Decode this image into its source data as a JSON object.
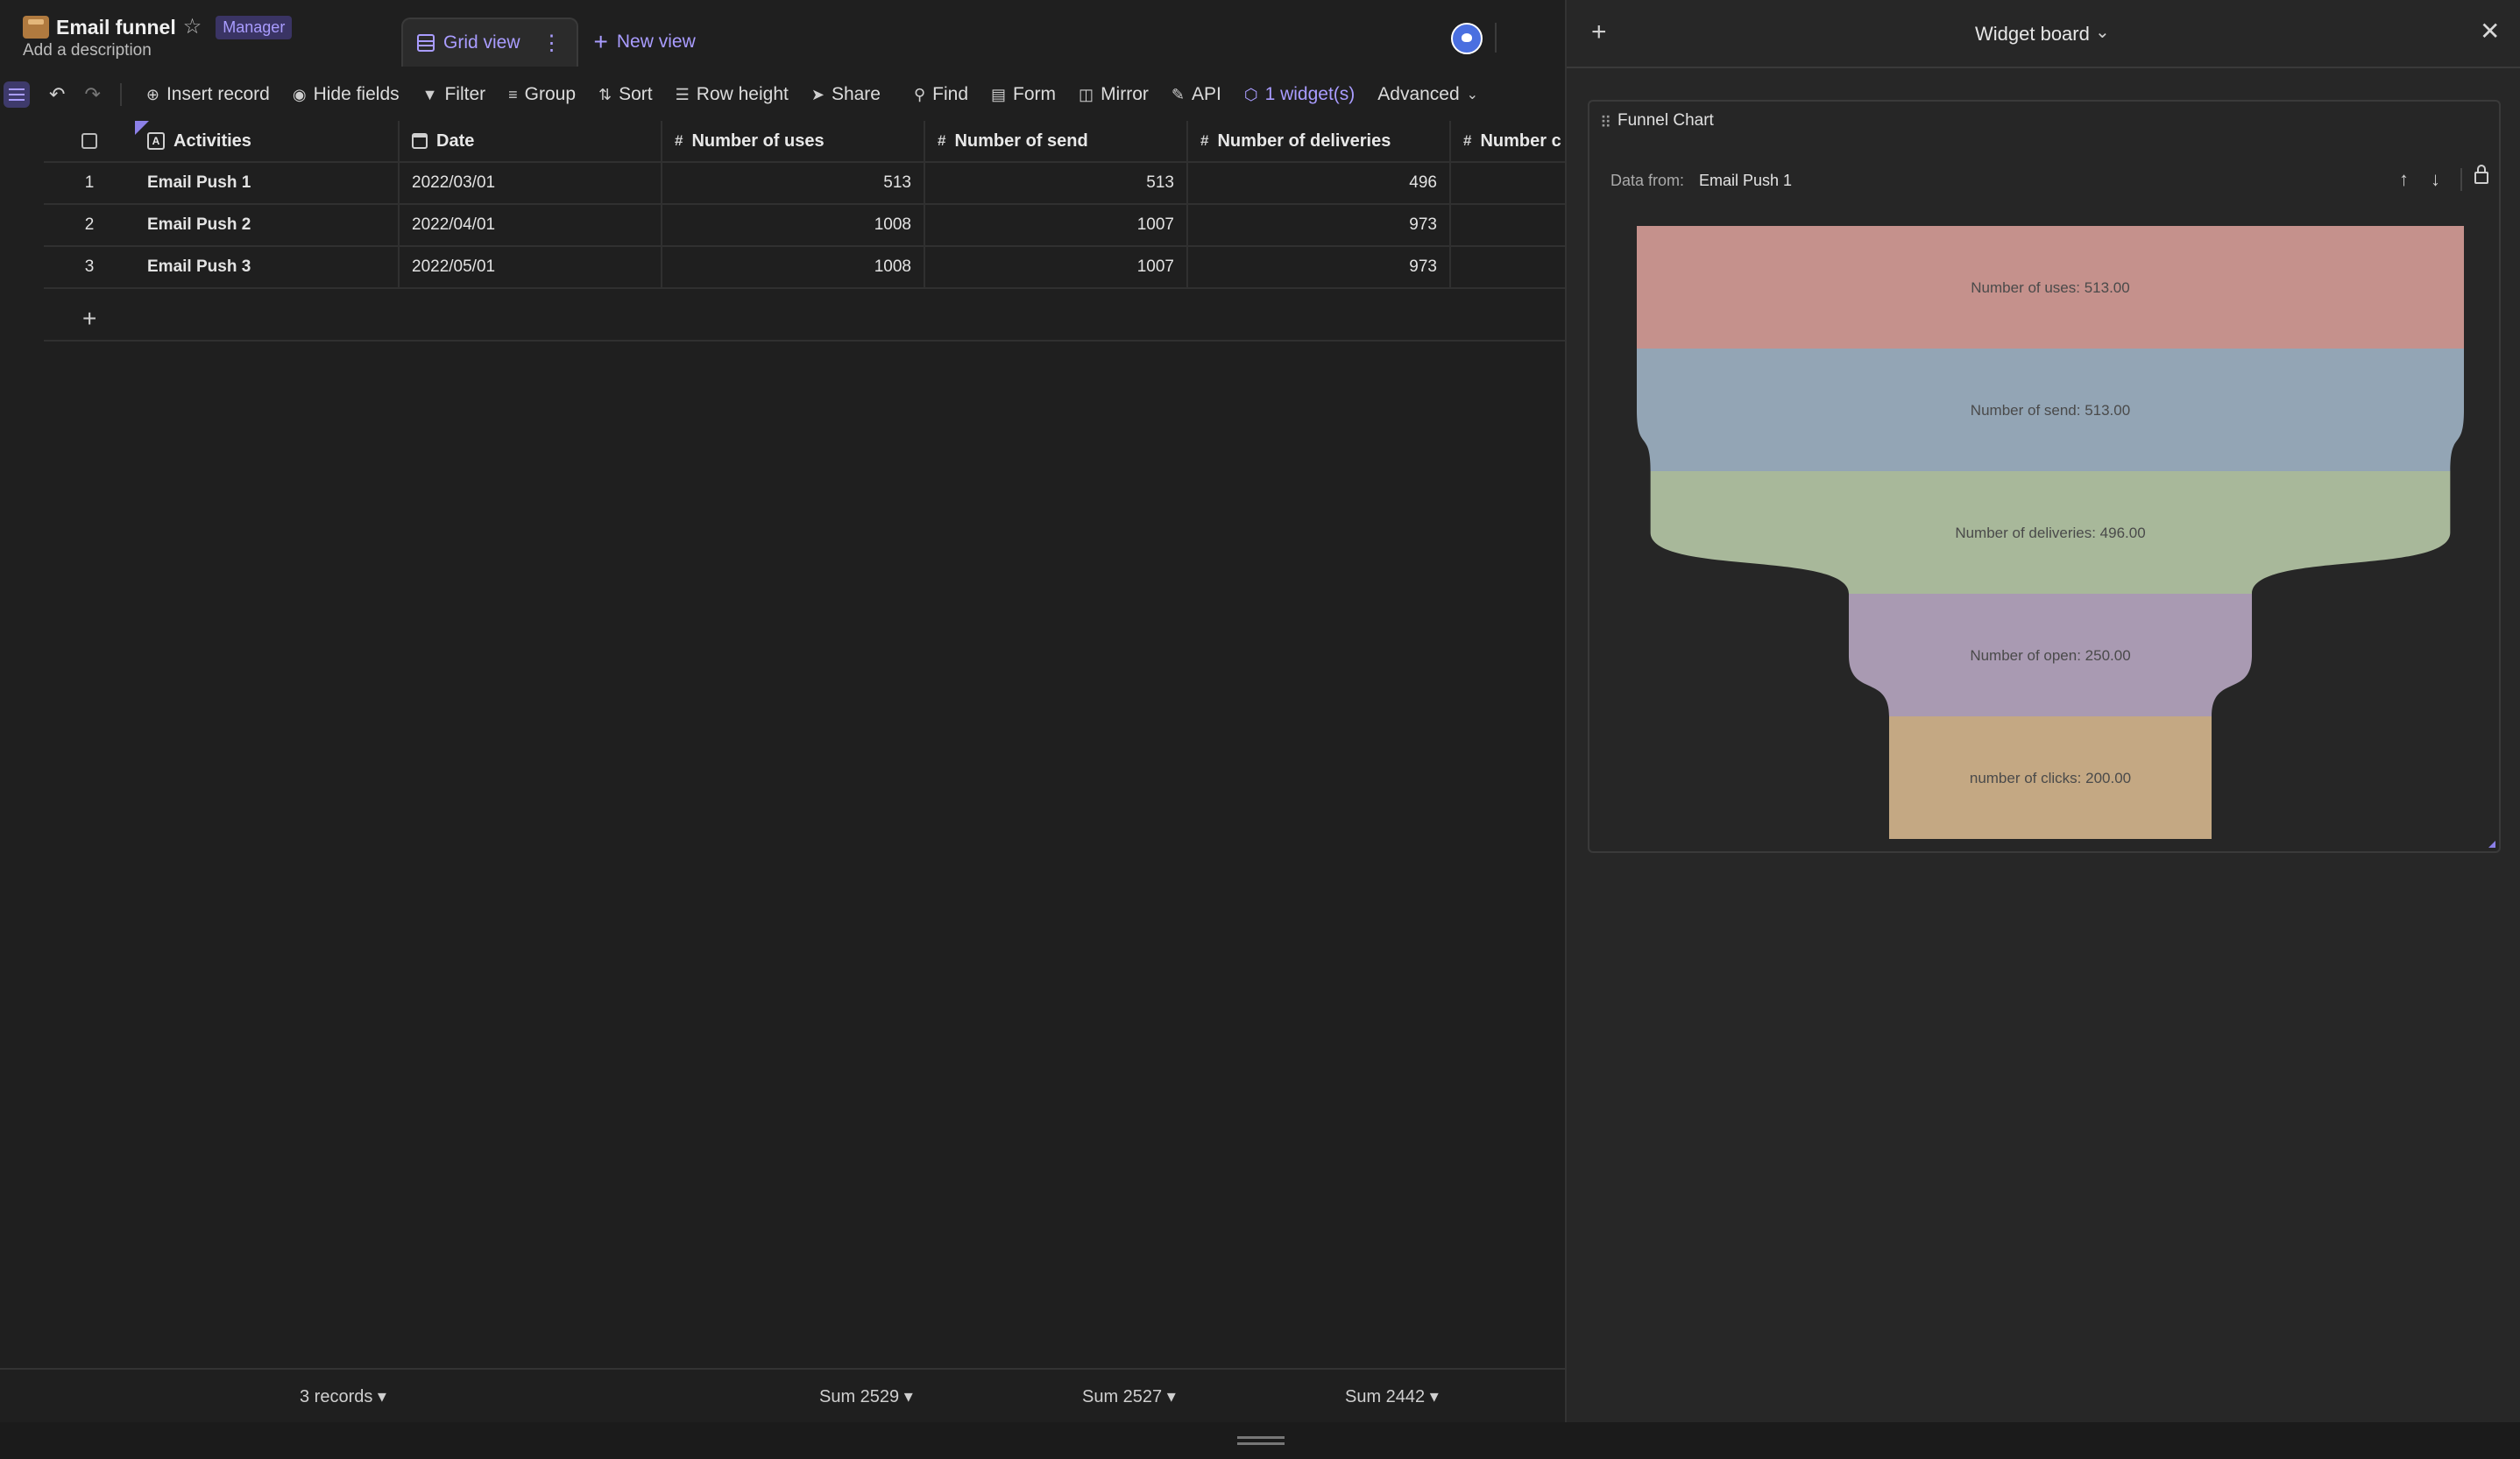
{
  "header": {
    "title": "Email funnel",
    "role": "Manager",
    "description": "Add a description"
  },
  "views": {
    "active": "Grid view",
    "new_view": "New view"
  },
  "toolbar": {
    "insert_record": "Insert record",
    "hide_fields": "Hide fields",
    "filter": "Filter",
    "group": "Group",
    "sort": "Sort",
    "row_height": "Row height",
    "share": "Share",
    "find": "Find",
    "form": "Form",
    "mirror": "Mirror",
    "api": "API",
    "widgets": "1 widget(s)",
    "advanced": "Advanced"
  },
  "table": {
    "columns": [
      "Activities",
      "Date",
      "Number of uses",
      "Number of send",
      "Number of deliveries",
      "Number c"
    ],
    "rows": [
      {
        "index": "1",
        "activity": "Email Push 1",
        "date": "2022/03/01",
        "uses": "513",
        "send": "513",
        "deliveries": "496"
      },
      {
        "index": "2",
        "activity": "Email Push 2",
        "date": "2022/04/01",
        "uses": "1008",
        "send": "1007",
        "deliveries": "973"
      },
      {
        "index": "3",
        "activity": "Email Push 3",
        "date": "2022/05/01",
        "uses": "1008",
        "send": "1007",
        "deliveries": "973"
      }
    ]
  },
  "footer": {
    "records": "3 records ▾",
    "sum_uses": "Sum 2529 ▾",
    "sum_send": "Sum 2527 ▾",
    "sum_deliveries": "Sum 2442 ▾"
  },
  "widget_board": {
    "title": "Widget board",
    "widget_title": "Funnel Chart",
    "data_from_label": "Data from:",
    "data_from_value": "Email Push 1"
  },
  "chart_data": {
    "type": "funnel",
    "stages": [
      {
        "label": "Number of uses:",
        "value": 513.0,
        "display": "513.00",
        "color": "#c5918c"
      },
      {
        "label": "Number of send:",
        "value": 513.0,
        "display": "513.00",
        "color": "#93a5b5"
      },
      {
        "label": "Number of deliveries:",
        "value": 496.0,
        "display": "496.00",
        "color": "#a8b89a"
      },
      {
        "label": "Number of open:",
        "value": 250.0,
        "display": "250.00",
        "color": "#a99ab2"
      },
      {
        "label": "number of clicks:",
        "value": 200.0,
        "display": "200.00",
        "color": "#c4a883"
      }
    ]
  }
}
